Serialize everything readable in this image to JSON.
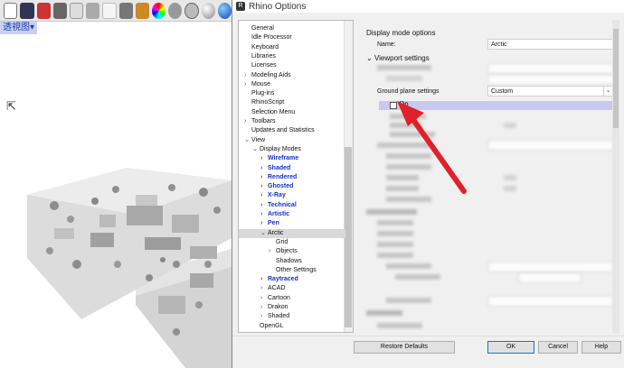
{
  "rhino": {
    "toolbar_icons": [
      "grid-icon",
      "layout-icon",
      "car-icon",
      "pen-icon",
      "curve-icon",
      "key-icon",
      "bulb-icon",
      "box-icon",
      "material-icon",
      "color-wheel-icon",
      "render-icon",
      "grid-sphere-icon",
      "sphere-icon",
      "blue-sphere-icon"
    ],
    "viewport_tab": "透視图▾"
  },
  "dialog": {
    "title": "Rhino Options",
    "tree": [
      {
        "label": "General",
        "indent": 0,
        "chev": ""
      },
      {
        "label": "Idle Processor",
        "indent": 0,
        "chev": ""
      },
      {
        "label": "Keyboard",
        "indent": 0,
        "chev": ""
      },
      {
        "label": "Libraries",
        "indent": 0,
        "chev": ""
      },
      {
        "label": "Licenses",
        "indent": 0,
        "chev": ""
      },
      {
        "label": "Modeling Aids",
        "indent": 0,
        "chev": ">"
      },
      {
        "label": "Mouse",
        "indent": 0,
        "chev": ">"
      },
      {
        "label": "Plug-ins",
        "indent": 0,
        "chev": ""
      },
      {
        "label": "RhinoScript",
        "indent": 0,
        "chev": ""
      },
      {
        "label": "Selection Menu",
        "indent": 0,
        "chev": ""
      },
      {
        "label": "Toolbars",
        "indent": 0,
        "chev": ">"
      },
      {
        "label": "Updates and Statistics",
        "indent": 0,
        "chev": ""
      },
      {
        "label": "View",
        "indent": 0,
        "chev": "v"
      },
      {
        "label": "Display Modes",
        "indent": 1,
        "chev": "v"
      },
      {
        "label": "Wireframe",
        "indent": 2,
        "chev": ">",
        "blue": true
      },
      {
        "label": "Shaded",
        "indent": 2,
        "chev": ">",
        "blue": true
      },
      {
        "label": "Rendered",
        "indent": 2,
        "chev": ">",
        "blue": true
      },
      {
        "label": "Ghosted",
        "indent": 2,
        "chev": ">",
        "blue": true
      },
      {
        "label": "X-Ray",
        "indent": 2,
        "chev": ">",
        "blue": true
      },
      {
        "label": "Technical",
        "indent": 2,
        "chev": ">",
        "blue": true
      },
      {
        "label": "Artistic",
        "indent": 2,
        "chev": ">",
        "blue": true
      },
      {
        "label": "Pen",
        "indent": 2,
        "chev": ">",
        "blue": true
      },
      {
        "label": "Arctic",
        "indent": 2,
        "chev": "v",
        "selected": true
      },
      {
        "label": "Grid",
        "indent": 3,
        "chev": ""
      },
      {
        "label": "Objects",
        "indent": 3,
        "chev": ">"
      },
      {
        "label": "Shadows",
        "indent": 3,
        "chev": ""
      },
      {
        "label": "Other Settings",
        "indent": 3,
        "chev": ""
      },
      {
        "label": "Raytraced",
        "indent": 2,
        "chev": ">",
        "blue": true
      },
      {
        "label": "ACAD",
        "indent": 2,
        "chev": ">"
      },
      {
        "label": "Cartoon",
        "indent": 2,
        "chev": ">"
      },
      {
        "label": "Drakon",
        "indent": 2,
        "chev": ">"
      },
      {
        "label": "Shaded",
        "indent": 2,
        "chev": ">"
      },
      {
        "label": "OpenGL",
        "indent": 1,
        "chev": ""
      }
    ],
    "panel": {
      "section_display": "Display mode options",
      "name_label": "Name:",
      "name_value": "Arctic",
      "section_viewport": "Viewport settings",
      "ground_plane_label": "Ground plane settings",
      "ground_plane_value": "Custom",
      "on_label": "On"
    },
    "buttons": {
      "restore": "Restore Defaults",
      "ok": "OK",
      "cancel": "Cancel",
      "help": "Help"
    }
  },
  "colors": {
    "arrow": "#e0202a",
    "highlight": "#c9c8f0",
    "blue_text": "#1432c8"
  }
}
